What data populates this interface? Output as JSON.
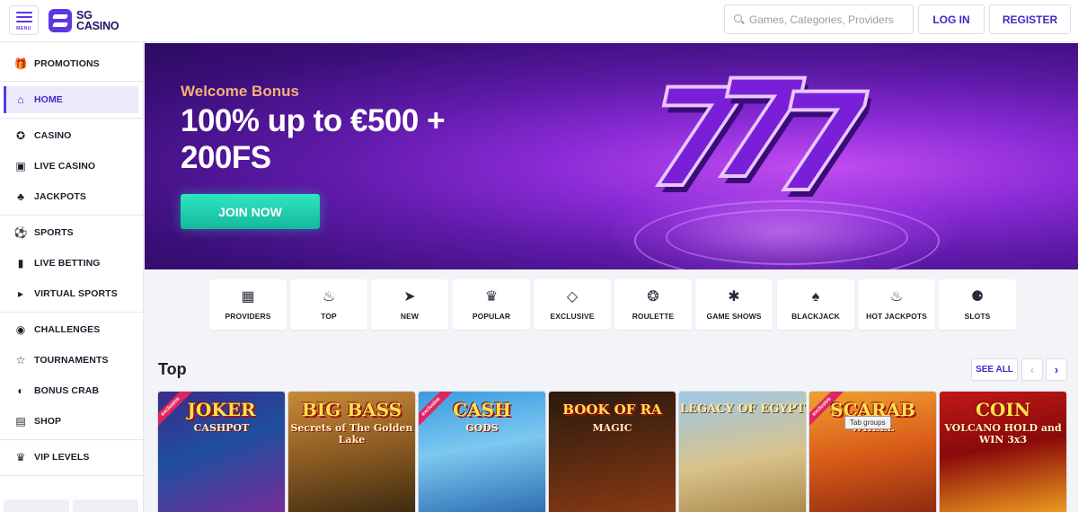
{
  "header": {
    "menu_label": "MENU",
    "logo_line1": "SG",
    "logo_line2": "CASINO",
    "search_placeholder": "Games, Categories, Providers",
    "login_label": "LOG IN",
    "register_label": "REGISTER"
  },
  "sidebar": {
    "items": [
      {
        "label": "PROMOTIONS",
        "icon": "gift-icon"
      },
      {
        "label": "HOME",
        "icon": "home-icon",
        "active": true
      },
      {
        "label": "CASINO",
        "icon": "chip-icon"
      },
      {
        "label": "LIVE CASINO",
        "icon": "cards-icon"
      },
      {
        "label": "JACKPOTS",
        "icon": "clover-icon"
      },
      {
        "label": "SPORTS",
        "icon": "soccer-ball-icon"
      },
      {
        "label": "LIVE BETTING",
        "icon": "live-icon"
      },
      {
        "label": "VIRTUAL SPORTS",
        "icon": "virtual-icon"
      },
      {
        "label": "CHALLENGES",
        "icon": "medal-icon"
      },
      {
        "label": "TOURNAMENTS",
        "icon": "trophy-icon"
      },
      {
        "label": "BONUS CRAB",
        "icon": "claw-icon"
      },
      {
        "label": "SHOP",
        "icon": "bag-icon"
      },
      {
        "label": "VIP LEVELS",
        "icon": "crown-icon"
      }
    ]
  },
  "banner": {
    "subtitle": "Welcome Bonus",
    "title": "100% up to €500 + 200FS",
    "cta_label": "JOIN NOW"
  },
  "categories": [
    {
      "label": "PROVIDERS",
      "icon": "grid-icon"
    },
    {
      "label": "TOP",
      "icon": "flame-icon"
    },
    {
      "label": "NEW",
      "icon": "rocket-icon"
    },
    {
      "label": "POPULAR",
      "icon": "crown-icon"
    },
    {
      "label": "EXCLUSIVE",
      "icon": "diamond-icon"
    },
    {
      "label": "ROULETTE",
      "icon": "roulette-icon"
    },
    {
      "label": "GAME SHOWS",
      "icon": "wheel-icon"
    },
    {
      "label": "BLACKJACK",
      "icon": "spade-icon"
    },
    {
      "label": "HOT JACKPOTS",
      "icon": "fire-icon"
    },
    {
      "label": "SLOTS",
      "icon": "cherry-icon"
    }
  ],
  "top_section": {
    "title": "Top",
    "see_all_label": "SEE ALL",
    "prev_arrow": "‹",
    "next_arrow": "›"
  },
  "games": [
    {
      "title": "JOKER",
      "subtitle": "CASHPOT",
      "exclusive": true
    },
    {
      "title": "BIG BASS",
      "subtitle": "Secrets of The Golden Lake",
      "exclusive": false
    },
    {
      "title": "CASH",
      "subtitle": "GODS",
      "exclusive": true
    },
    {
      "title": "BOOK OF RA",
      "subtitle": "MAGIC",
      "exclusive": false
    },
    {
      "title": "LEGACY OF EGYPT",
      "subtitle": "",
      "exclusive": false
    },
    {
      "title": "SCARAB",
      "subtitle": "WHEEL",
      "exclusive": true
    },
    {
      "title": "COIN",
      "subtitle": "VOLCANO HOLD and WIN 3x3",
      "exclusive": false
    }
  ],
  "exclusive_label": "exclusive",
  "tooltip_text": "Tab groups"
}
